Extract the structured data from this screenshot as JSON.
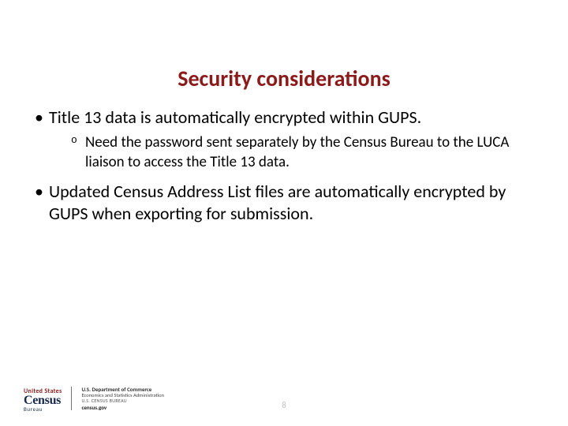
{
  "title": "Security considerations",
  "bullets": [
    {
      "text": "Title 13 data is automatically encrypted within GUPS.",
      "sub": [
        "Need the password sent separately by the Census Bureau to the LUCA liaison to access the Title 13 data."
      ]
    },
    {
      "text": "Updated Census Address List files are automatically encrypted by GUPS when exporting for submission.",
      "sub": []
    }
  ],
  "footer": {
    "logo_us": "United States",
    "logo_main": "Census",
    "logo_bureau": "Bureau",
    "dept1": "U.S. Department of Commerce",
    "dept2": "Economics and Statistics Administration",
    "dept3": "U.S. CENSUS BUREAU",
    "site": "census.gov"
  },
  "page_number": "8"
}
